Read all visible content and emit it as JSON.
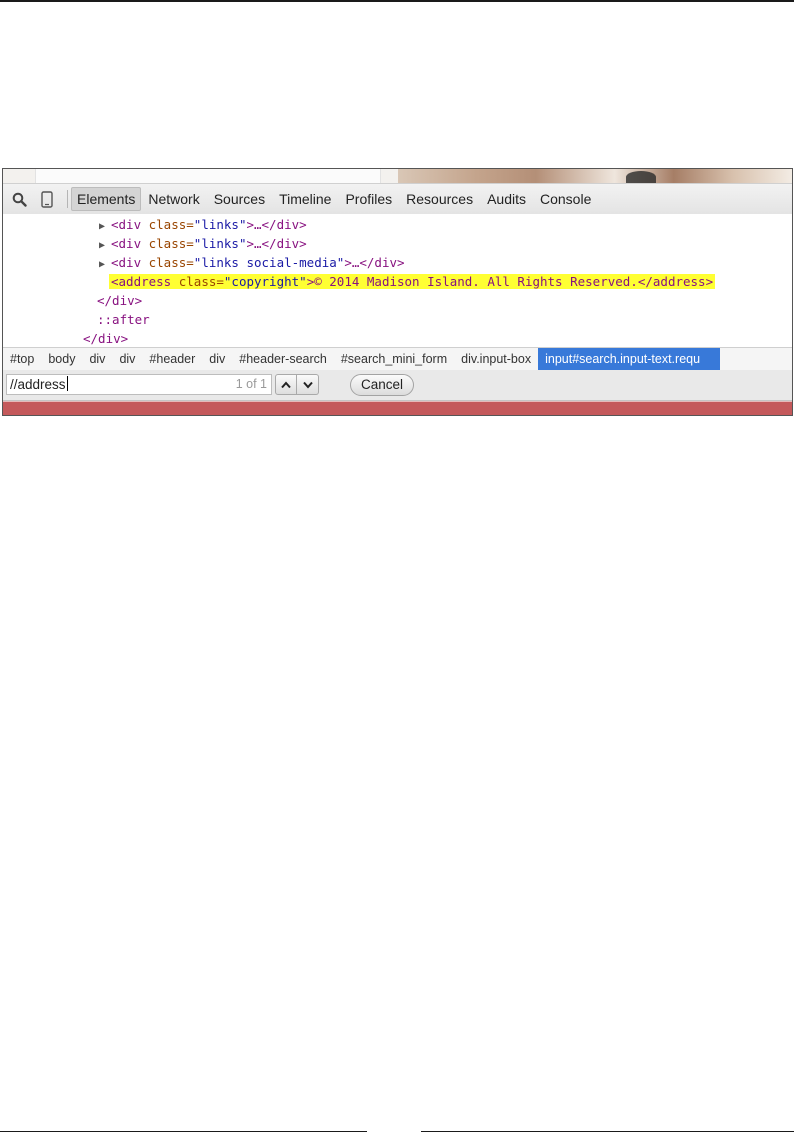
{
  "toolbar": {
    "search_icon": "magnifier-icon",
    "device_icon": "mobile-device-icon",
    "tabs": [
      {
        "label": "Elements",
        "active": true
      },
      {
        "label": "Network"
      },
      {
        "label": "Sources"
      },
      {
        "label": "Timeline"
      },
      {
        "label": "Profiles"
      },
      {
        "label": "Resources"
      },
      {
        "label": "Audits"
      },
      {
        "label": "Console"
      }
    ]
  },
  "dom_tree": {
    "row1": {
      "open": "<div",
      "attr": " class=",
      "value": "\"links\"",
      "rest": ">…</div>"
    },
    "row2": {
      "open": "<div",
      "attr": " class=",
      "value": "\"links\"",
      "rest": ">…</div>"
    },
    "row3": {
      "open": "<div",
      "attr": " class=",
      "value": "\"links social-media\"",
      "rest": ">…</div>"
    },
    "row4": {
      "open": "<address",
      "attr": " class=",
      "value": "\"copyright\"",
      "text": ">© 2014 Madison Island. All Rights Reserved.",
      "close": "</address>"
    },
    "row5": "</div>",
    "row6": "::after",
    "row7": "</div>"
  },
  "breadcrumb": [
    "#top",
    "body",
    "div",
    "div",
    "#header",
    "div",
    "#header-search",
    "#search_mini_form",
    "div.input-box",
    "input#search.input-text.requ"
  ],
  "findbar": {
    "query": "//address",
    "count": "1 of 1",
    "cancel_label": "Cancel"
  },
  "colors": {
    "tag": "#881280",
    "attribute": "#994500",
    "attribute_value": "#1a1aa6",
    "highlight": "#ffff33",
    "breadcrumb_active": "#3879d9"
  }
}
